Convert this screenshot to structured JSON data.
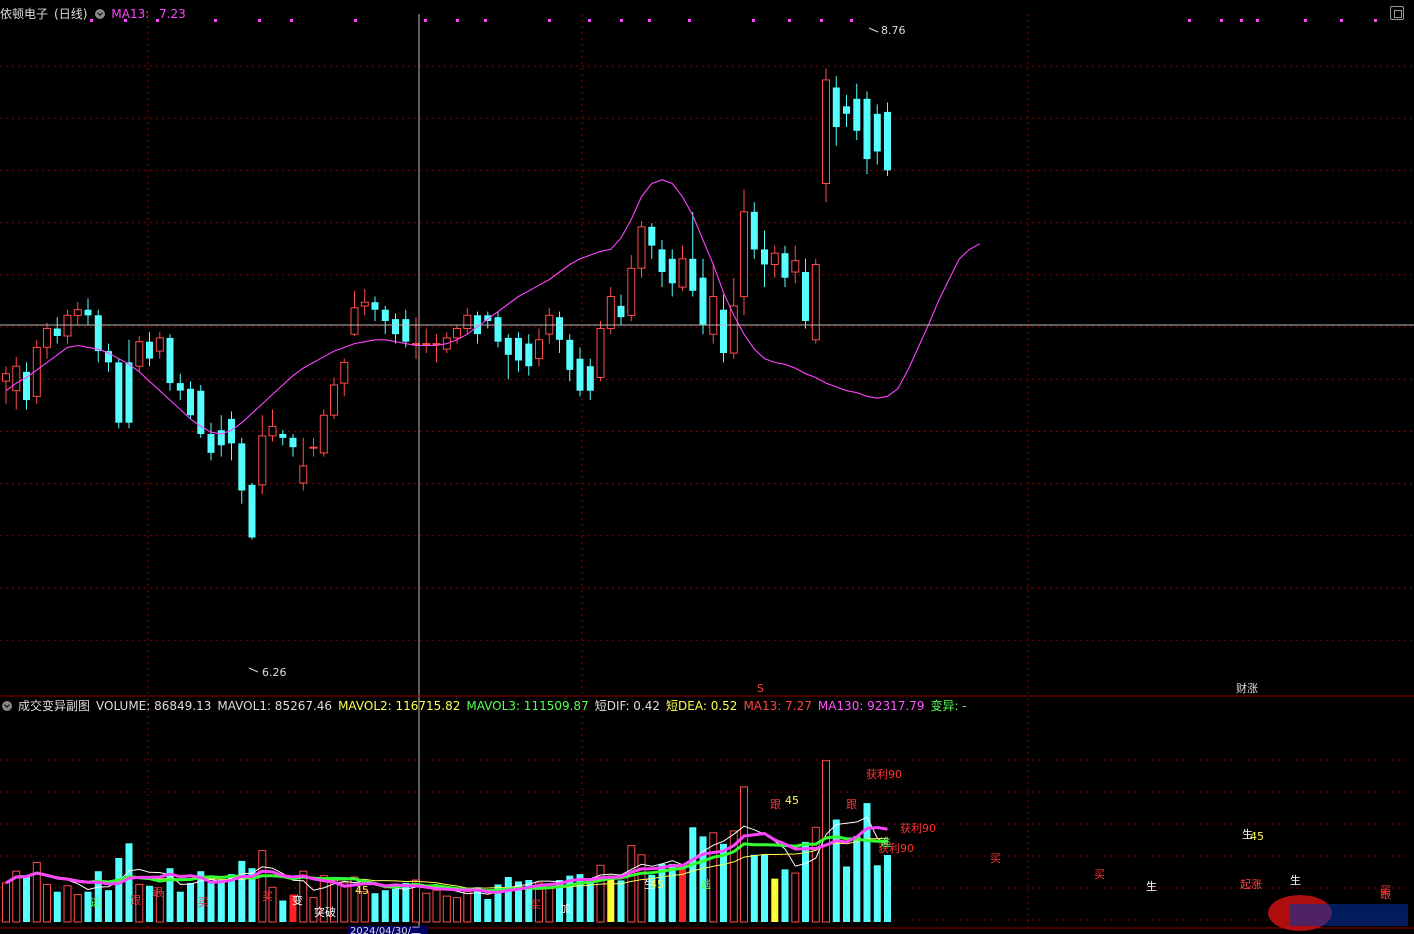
{
  "window": {
    "stock_name": "依顿电子",
    "period_label": "(日线)",
    "ma_label": "MA13:",
    "ma_value": "7.23"
  },
  "sub_panel": {
    "title": "成交变异副图",
    "indicators": [
      {
        "label": "VOLUME:",
        "value": "86849.13",
        "color": "#dddddd"
      },
      {
        "label": "MAVOL1:",
        "value": "85267.46",
        "color": "#dddddd"
      },
      {
        "label": "MAVOL2:",
        "value": "116715.82",
        "color": "#ffff55"
      },
      {
        "label": "MAVOL3:",
        "value": "111509.87",
        "color": "#55ff55"
      },
      {
        "label": "短DIF:",
        "value": "0.42",
        "color": "#dddddd"
      },
      {
        "label": "短DEA:",
        "value": "0.52",
        "color": "#ffff55"
      },
      {
        "label": "MA13:",
        "value": "7.27",
        "color": "#ff4444"
      },
      {
        "label": "MA130:",
        "value": "92317.79",
        "color": "#ff55ff"
      },
      {
        "label": "变异:",
        "value": "-",
        "color": "#55ff55"
      }
    ]
  },
  "colors": {
    "up": "#ff4c4c",
    "down": "#55ffff",
    "ma13": "#ff44ff",
    "grid": "#8b0000",
    "crosshair": "#bbbbbb",
    "mavol1": "#ffffff",
    "mavol2": "#ffff55",
    "mavol3": "#33ff33",
    "ma_vol_line": "#ff44ff"
  },
  "chart_data": [
    {
      "type": "candlestick",
      "title": "依顿电子(日线)",
      "ylim": [
        5.45,
        9.05
      ],
      "max_label": "8.76",
      "min_label": "6.26",
      "series": [
        {
          "name": "MA13",
          "values": [
            7.05,
            7.09,
            7.12,
            7.16,
            7.2,
            7.24,
            7.28,
            7.29,
            7.28,
            7.27,
            7.25,
            7.22,
            7.19,
            7.15,
            7.1,
            7.05,
            7.0,
            6.95,
            6.9,
            6.86,
            6.83,
            6.82,
            6.84,
            6.88,
            6.93,
            6.98,
            7.03,
            7.08,
            7.13,
            7.17,
            7.2,
            7.23,
            7.26,
            7.28,
            7.3,
            7.31,
            7.32,
            7.32,
            7.31,
            7.3,
            7.29,
            7.29,
            7.29,
            7.3,
            7.32,
            7.35,
            7.39,
            7.43,
            7.47,
            7.51,
            7.55,
            7.58,
            7.61,
            7.64,
            7.68,
            7.72,
            7.75,
            7.77,
            7.79,
            7.8,
            7.86,
            7.96,
            8.08,
            8.15,
            8.17,
            8.15,
            8.08,
            7.98,
            7.85,
            7.72,
            7.57,
            7.45,
            7.35,
            7.27,
            7.22,
            7.2,
            7.19,
            7.17,
            7.14,
            7.12,
            7.09,
            7.07,
            7.05,
            7.04,
            7.02,
            7.01,
            7.02,
            7.06,
            7.16,
            7.28,
            7.4,
            7.53,
            7.64,
            7.75,
            7.8,
            7.83
          ]
        }
      ],
      "candles": [
        [
          7.1,
          7.14,
          6.98,
          7.18
        ],
        [
          7.05,
          7.18,
          6.95,
          7.23
        ],
        [
          7.15,
          7.0,
          6.95,
          7.2
        ],
        [
          7.02,
          7.28,
          6.98,
          7.32
        ],
        [
          7.28,
          7.38,
          7.22,
          7.41
        ],
        [
          7.38,
          7.34,
          7.3,
          7.44
        ],
        [
          7.34,
          7.45,
          7.3,
          7.48
        ],
        [
          7.45,
          7.48,
          7.4,
          7.52
        ],
        [
          7.48,
          7.45,
          7.4,
          7.54
        ],
        [
          7.45,
          7.26,
          7.2,
          7.48
        ],
        [
          7.26,
          7.2,
          7.15,
          7.3
        ],
        [
          7.2,
          6.88,
          6.85,
          7.22
        ],
        [
          7.2,
          6.88,
          6.85,
          7.32
        ],
        [
          7.18,
          7.31,
          7.15,
          7.34
        ],
        [
          7.31,
          7.22,
          7.18,
          7.36
        ],
        [
          7.26,
          7.33,
          7.22,
          7.36
        ],
        [
          7.33,
          7.09,
          7.05,
          7.35
        ],
        [
          7.09,
          7.05,
          7.0,
          7.14
        ],
        [
          7.06,
          6.92,
          6.9,
          7.1
        ],
        [
          7.05,
          6.82,
          6.8,
          7.08
        ],
        [
          6.82,
          6.72,
          6.68,
          6.88
        ],
        [
          6.84,
          6.76,
          6.7,
          6.92
        ],
        [
          6.9,
          6.77,
          6.68,
          6.94
        ],
        [
          6.77,
          6.52,
          6.45,
          6.8
        ],
        [
          6.55,
          6.27,
          6.26,
          6.56
        ],
        [
          6.55,
          6.81,
          6.5,
          6.92
        ],
        [
          6.81,
          6.86,
          6.78,
          6.95
        ],
        [
          6.82,
          6.8,
          6.76,
          6.84
        ],
        [
          6.8,
          6.75,
          6.7,
          6.82
        ],
        [
          6.56,
          6.65,
          6.52,
          6.8
        ],
        [
          6.75,
          6.75,
          6.7,
          6.8
        ],
        [
          6.72,
          6.92,
          6.7,
          6.95
        ],
        [
          6.92,
          7.08,
          6.9,
          7.12
        ],
        [
          7.09,
          7.2,
          7.02,
          7.22
        ],
        [
          7.35,
          7.49,
          7.34,
          7.58
        ],
        [
          7.5,
          7.52,
          7.45,
          7.59
        ],
        [
          7.52,
          7.48,
          7.42,
          7.55
        ],
        [
          7.48,
          7.42,
          7.35,
          7.5
        ],
        [
          7.43,
          7.35,
          7.3,
          7.46
        ],
        [
          7.43,
          7.31,
          7.28,
          7.48
        ],
        [
          7.3,
          7.3,
          7.22,
          7.44
        ],
        [
          7.3,
          7.3,
          7.25,
          7.38
        ],
        [
          7.3,
          7.3,
          7.2,
          7.35
        ],
        [
          7.27,
          7.33,
          7.25,
          7.36
        ],
        [
          7.33,
          7.38,
          7.3,
          7.4
        ],
        [
          7.38,
          7.45,
          7.35,
          7.49
        ],
        [
          7.45,
          7.35,
          7.3,
          7.47
        ],
        [
          7.45,
          7.42,
          7.38,
          7.47
        ],
        [
          7.44,
          7.31,
          7.28,
          7.47
        ],
        [
          7.33,
          7.24,
          7.11,
          7.35
        ],
        [
          7.33,
          7.21,
          7.15,
          7.36
        ],
        [
          7.3,
          7.18,
          7.13,
          7.35
        ],
        [
          7.22,
          7.32,
          7.18,
          7.38
        ],
        [
          7.35,
          7.45,
          7.3,
          7.49
        ],
        [
          7.44,
          7.32,
          7.25,
          7.47
        ],
        [
          7.32,
          7.16,
          7.1,
          7.35
        ],
        [
          7.22,
          7.05,
          7.02,
          7.28
        ],
        [
          7.18,
          7.05,
          7.0,
          7.22
        ],
        [
          7.12,
          7.38,
          7.1,
          7.42
        ],
        [
          7.38,
          7.55,
          7.35,
          7.6
        ],
        [
          7.5,
          7.44,
          7.4,
          7.56
        ],
        [
          7.45,
          7.7,
          7.42,
          7.77
        ],
        [
          7.7,
          7.92,
          7.65,
          7.95
        ],
        [
          7.92,
          7.82,
          7.75,
          7.94
        ],
        [
          7.8,
          7.68,
          7.6,
          7.85
        ],
        [
          7.75,
          7.62,
          7.55,
          7.8
        ],
        [
          7.6,
          7.75,
          7.58,
          7.82
        ],
        [
          7.75,
          7.58,
          7.55,
          8.0
        ],
        [
          7.65,
          7.4,
          7.35,
          7.75
        ],
        [
          7.35,
          7.55,
          7.3,
          7.72
        ],
        [
          7.48,
          7.25,
          7.2,
          7.56
        ],
        [
          7.25,
          7.5,
          7.22,
          7.65
        ],
        [
          7.55,
          8.0,
          7.45,
          8.12
        ],
        [
          8.0,
          7.8,
          7.75,
          8.05
        ],
        [
          7.8,
          7.72,
          7.6,
          7.9
        ],
        [
          7.72,
          7.78,
          7.65,
          7.82
        ],
        [
          7.78,
          7.65,
          7.6,
          7.82
        ],
        [
          7.68,
          7.74,
          7.62,
          7.82
        ],
        [
          7.68,
          7.42,
          7.38,
          7.75
        ],
        [
          7.32,
          7.72,
          7.3,
          7.75
        ],
        [
          8.15,
          8.7,
          8.05,
          8.76
        ],
        [
          8.66,
          8.45,
          8.35,
          8.72
        ],
        [
          8.56,
          8.52,
          8.45,
          8.62
        ],
        [
          8.6,
          8.43,
          8.38,
          8.68
        ],
        [
          8.6,
          8.28,
          8.2,
          8.64
        ],
        [
          8.52,
          8.32,
          8.25,
          8.57
        ],
        [
          8.53,
          8.22,
          8.19,
          8.58
        ]
      ]
    },
    {
      "type": "bar",
      "title": "成交变异副图",
      "ylim": [
        0,
        360000
      ],
      "series": [
        {
          "name": "VOLUME"
        },
        {
          "name": "MAVOL1",
          "value": 85267.46
        },
        {
          "name": "MAVOL2",
          "value": 116715.82
        },
        {
          "name": "MAVOL3",
          "value": 111509.87
        }
      ],
      "labels": [
        {
          "text": "获利90",
          "color": "#ff3333"
        },
        {
          "text": "获利90",
          "color": "#ff3333"
        },
        {
          "text": "获利90",
          "color": "#ff3333"
        },
        {
          "text": "45",
          "color": "#ffff55"
        },
        {
          "text": "45",
          "color": "#ffff55"
        },
        {
          "text": "45",
          "color": "#ffff55"
        },
        {
          "text": "45",
          "color": "#ffff55"
        },
        {
          "text": "突破",
          "color": "#ffffff"
        },
        {
          "text": "跟",
          "color": "#ff3333"
        },
        {
          "text": "跟",
          "color": "#ff3333"
        },
        {
          "text": "跟",
          "color": "#ff3333"
        },
        {
          "text": "跟",
          "color": "#ff3333"
        },
        {
          "text": "跟",
          "color": "#ff3333"
        },
        {
          "text": "逃",
          "color": "#55ff55"
        },
        {
          "text": "逃",
          "color": "#55ff55"
        },
        {
          "text": "逃",
          "color": "#55ff55"
        },
        {
          "text": "买",
          "color": "#ff3333"
        },
        {
          "text": "买",
          "color": "#ff3333"
        },
        {
          "text": "买",
          "color": "#ff3333"
        },
        {
          "text": "买",
          "color": "#ff3333"
        },
        {
          "text": "买",
          "color": "#ff3333"
        },
        {
          "text": "买",
          "color": "#ff3333"
        },
        {
          "text": "加",
          "color": "#ffffff"
        },
        {
          "text": "生",
          "color": "#ffffff"
        },
        {
          "text": "生",
          "color": "#ffffff"
        },
        {
          "text": "生",
          "color": "#ffffff"
        },
        {
          "text": "生",
          "color": "#ffffff"
        },
        {
          "text": "变",
          "color": "#ffffff"
        },
        {
          "text": "起涨",
          "color": "#ff4444"
        }
      ],
      "tags": [
        "S",
        "财涨"
      ],
      "date_label": "2024/04/30/二"
    }
  ]
}
